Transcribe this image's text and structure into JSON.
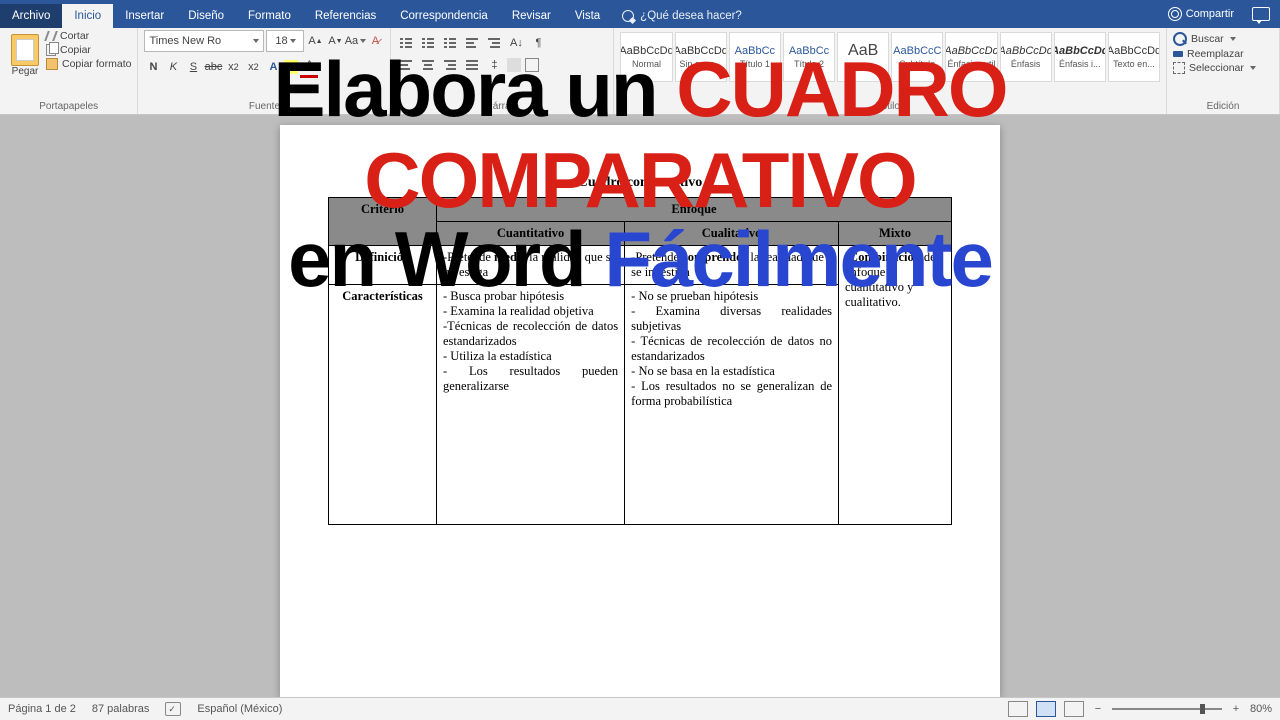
{
  "titlebar": {
    "share": "Compartir"
  },
  "tabs": {
    "file": "Archivo",
    "home": "Inicio",
    "insert": "Insertar",
    "design": "Diseño",
    "layout": "Formato",
    "references": "Referencias",
    "mailings": "Correspondencia",
    "review": "Revisar",
    "view": "Vista",
    "tellme": "¿Qué desea hacer?"
  },
  "ribbon": {
    "clipboard": {
      "title": "Portapapeles",
      "paste": "Pegar",
      "cut": "Cortar",
      "copy": "Copiar",
      "format": "Copiar formato"
    },
    "font": {
      "title": "Fuente",
      "name": "Times New Ro",
      "size": "18"
    },
    "paragraph": {
      "title": "Párrafo"
    },
    "styles": {
      "title": "Estilos",
      "items": [
        {
          "sample": "AaBbCcDd",
          "name": "Normal"
        },
        {
          "sample": "AaBbCcDd",
          "name": "Sin espa..."
        },
        {
          "sample": "AaBbCc",
          "name": "Título 1",
          "class": "blue"
        },
        {
          "sample": "AaBbCc",
          "name": "Título 2",
          "class": "blue"
        },
        {
          "sample": "AaB",
          "name": "Título",
          "class": "big"
        },
        {
          "sample": "AaBbCcC",
          "name": "Subtítulo",
          "class": "blue"
        },
        {
          "sample": "AaBbCcDd",
          "name": "Énfasis sutil",
          "class": "italic"
        },
        {
          "sample": "AaBbCcDd",
          "name": "Énfasis",
          "class": "italic"
        },
        {
          "sample": "AaBbCcDd",
          "name": "Énfasis i...",
          "class": "bolditalic"
        },
        {
          "sample": "AaBbCcDd",
          "name": "Texto en..."
        }
      ]
    },
    "editing": {
      "title": "Edición",
      "find": "Buscar",
      "replace": "Reemplazar",
      "select": "Seleccionar"
    }
  },
  "overlay": {
    "l1a": "Elabora un ",
    "l1b": "CUADRO COMPARATIVO",
    "l2a": "en Word ",
    "l2b": "Fácilmente"
  },
  "doc": {
    "title": "Cuadro comparativo",
    "hdr": {
      "criterio": "Criterio",
      "enfoque": "Enfoque",
      "cuant": "Cuantitativo",
      "cual": "Cualitativo",
      "mixto": "Mixto"
    },
    "row1": {
      "label": "Definición",
      "cuant_a": "-Pretende ",
      "cuant_b": "medir",
      "cuant_c": " la realidad que se investiga",
      "cual_a": "-Pretende ",
      "cual_b": "comprender",
      "cual_c": " la realidad que se investiga",
      "mixto_a": "-",
      "mixto_b": "Combinación",
      "mixto_c": " del enfoque cuantitativo y cualitativo."
    },
    "row2": {
      "label": "Características",
      "cuant": "- Busca probar hipótesis\n- Examina la realidad objetiva\n-Técnicas de recolección de datos estandarizados\n- Utiliza la estadística\n- Los resultados pueden generalizarse",
      "cual": "- No se prueban hipótesis\n- Examina diversas realidades subjetivas\n- Técnicas de recolección de datos no estandarizados\n- No se basa en la estadística\n- Los resultados no se generalizan de forma probabilística"
    }
  },
  "status": {
    "page": "Página 1 de 2",
    "words": "87 palabras",
    "lang": "Español (México)",
    "zoom": "80%"
  }
}
